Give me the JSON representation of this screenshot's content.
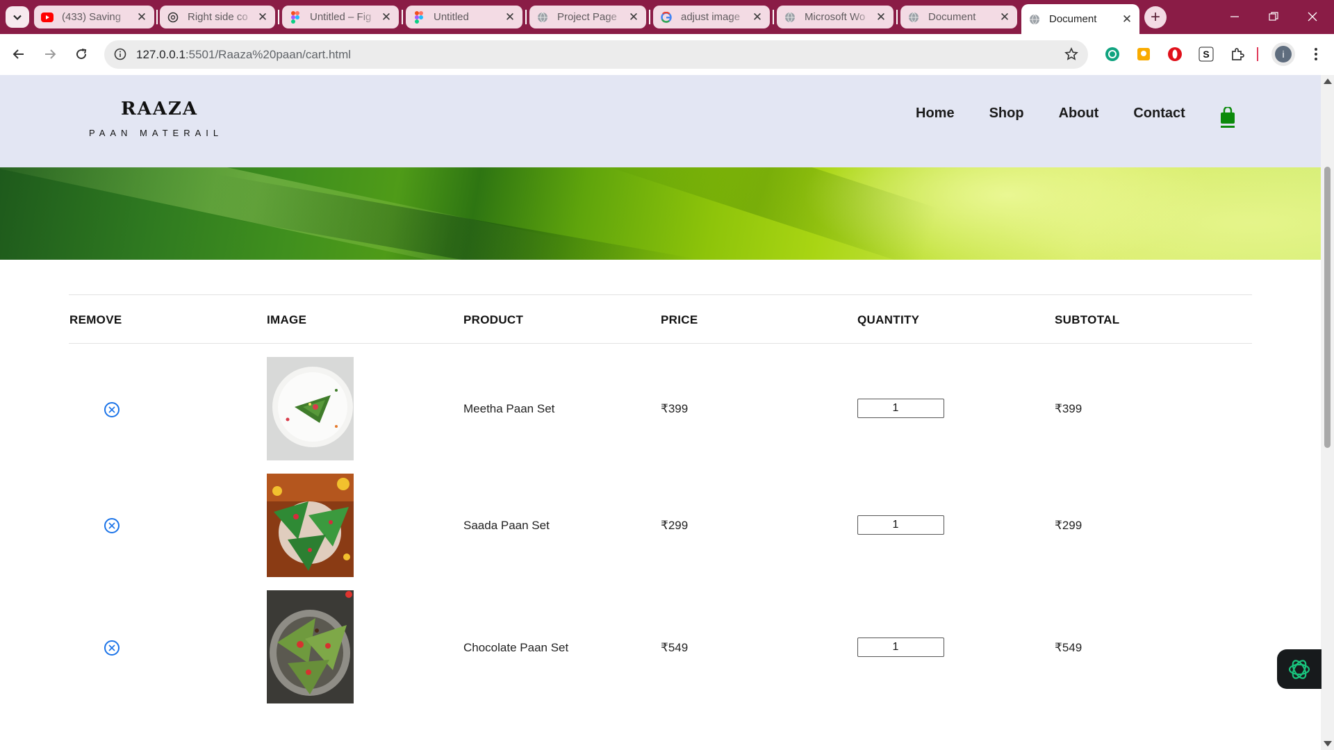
{
  "browser": {
    "tabs": [
      {
        "label": "(433) Saving",
        "icon": "youtube-icon"
      },
      {
        "label": "Right side co",
        "icon": "chatgpt-icon"
      },
      {
        "label": "Untitled – Fig",
        "icon": "figma-icon"
      },
      {
        "label": "Untitled",
        "icon": "figma-icon"
      },
      {
        "label": "Project Page",
        "icon": "globe-icon"
      },
      {
        "label": "adjust image",
        "icon": "google-icon"
      },
      {
        "label": "Microsoft Wo",
        "icon": "globe-icon"
      },
      {
        "label": "Document",
        "icon": "globe-icon"
      },
      {
        "label": "Document",
        "icon": "globe-icon",
        "active": true
      }
    ],
    "url_host": "127.0.0.1",
    "url_path": ":5501/Raaza%20paan/cart.html",
    "profile_initial": "i",
    "theme_color": "#8a1c46"
  },
  "site": {
    "logo": "RAAZA",
    "tagline": "PAAN MATERAIL",
    "nav": [
      "Home",
      "Shop",
      "About",
      "Contact"
    ],
    "cart_color": "#0b8a0b"
  },
  "cart": {
    "headers": [
      "REMOVE",
      "IMAGE",
      "PRODUCT",
      "PRICE",
      "QUANTITY",
      "SUBTOTAL"
    ],
    "items": [
      {
        "product": "Meetha Paan Set",
        "price": "₹399",
        "quantity": "1",
        "subtotal": "₹399"
      },
      {
        "product": "Saada Paan Set",
        "price": "₹299",
        "quantity": "1",
        "subtotal": "₹299"
      },
      {
        "product": "Chocolate Paan Set",
        "price": "₹549",
        "quantity": "1",
        "subtotal": "₹549"
      }
    ]
  }
}
